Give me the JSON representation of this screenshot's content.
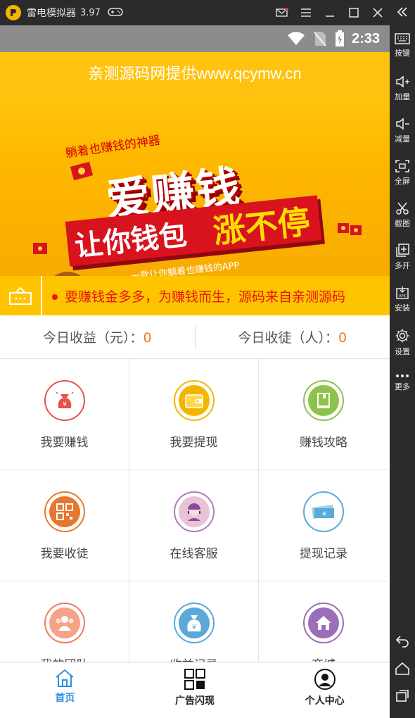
{
  "emulator": {
    "title": "雷电模拟器",
    "version": "3.97",
    "sidebar": [
      {
        "label": "按键",
        "icon": "keyboard-icon"
      },
      {
        "label": "加量",
        "icon": "volume-up-icon"
      },
      {
        "label": "减量",
        "icon": "volume-down-icon"
      },
      {
        "label": "全屏",
        "icon": "fullscreen-icon"
      },
      {
        "label": "截图",
        "icon": "scissors-icon"
      },
      {
        "label": "多开",
        "icon": "multi-open-icon"
      },
      {
        "label": "安装",
        "icon": "apk-install-icon"
      },
      {
        "label": "设置",
        "icon": "gear-icon"
      },
      {
        "label": "更多",
        "icon": "more-icon"
      }
    ]
  },
  "status": {
    "time": "2:33"
  },
  "banner": {
    "header": "亲测源码网提供www.qcymw.cn",
    "subtitle": "躺着也赚钱的神器",
    "headline": "爱赚钱",
    "ribbon_main": "让你钱包",
    "ribbon_accent": "涨不停",
    "slogan": "一款让你躺着也赚钱的APP"
  },
  "notice": {
    "text": "要赚钱金多多，为赚钱而生，源码来自亲测源码"
  },
  "stats": {
    "income_label": "今日收益（元）：",
    "income_value": "0",
    "apprentice_label": "今日收徒（人）：",
    "apprentice_value": "0"
  },
  "grid": [
    {
      "label": "我要赚钱",
      "icon": "money-bag-icon",
      "color": "#e8524a"
    },
    {
      "label": "我要提现",
      "icon": "wallet-icon",
      "color": "#f2b600"
    },
    {
      "label": "赚钱攻略",
      "icon": "book-icon",
      "color": "#8cc34b"
    },
    {
      "label": "我要收徒",
      "icon": "qrcode-icon",
      "color": "#e8772e"
    },
    {
      "label": "在线客服",
      "icon": "customer-service-icon",
      "color": "#b07ac0"
    },
    {
      "label": "提现记录",
      "icon": "cash-record-icon",
      "color": "#5aa9d8"
    },
    {
      "label": "我的团队",
      "icon": "team-icon",
      "color": "#f07a5a"
    },
    {
      "label": "收益记录",
      "icon": "income-bag-icon",
      "color": "#5aa9d8"
    },
    {
      "label": "商城",
      "icon": "home-icon",
      "color": "#9a6fb8"
    }
  ],
  "nav": {
    "home": "首页",
    "ads": "广告闪现",
    "profile": "个人中心"
  },
  "colors": {
    "accent": "#2f8fe0",
    "banner_yellow": "#ffc20e",
    "notice_red": "#e8150a",
    "stat_value": "#f07a1a"
  }
}
